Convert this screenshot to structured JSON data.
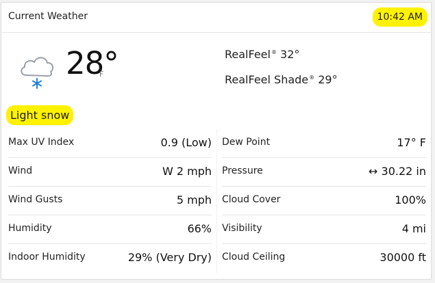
{
  "header": {
    "title": "Current Weather",
    "time": "10:42 AM"
  },
  "current": {
    "icon": "cloud-snow-icon",
    "temperature": "28°",
    "unit": "F",
    "realfeel": {
      "label": "RealFeel",
      "value": "32°"
    },
    "realfeel_shade": {
      "label": "RealFeel Shade",
      "value": "29°"
    },
    "tm": "®",
    "phrase": "Light snow"
  },
  "details_left": [
    {
      "label": "Max UV Index",
      "value": "0.9 (Low)"
    },
    {
      "label": "Wind",
      "value": "W 2 mph"
    },
    {
      "label": "Wind Gusts",
      "value": "5 mph"
    },
    {
      "label": "Humidity",
      "value": "66%"
    },
    {
      "label": "Indoor Humidity",
      "value": "29% (Very Dry)"
    }
  ],
  "details_right": [
    {
      "label": "Dew Point",
      "value": "17° F"
    },
    {
      "label": "Pressure",
      "value": "↔ 30.22 in"
    },
    {
      "label": "Cloud Cover",
      "value": "100%"
    },
    {
      "label": "Visibility",
      "value": "4 mi"
    },
    {
      "label": "Cloud Ceiling",
      "value": "30000 ft"
    }
  ],
  "colors": {
    "highlight": "#fff200",
    "snowflake": "#1e7fd8",
    "cloud": "#9aa0a6"
  }
}
